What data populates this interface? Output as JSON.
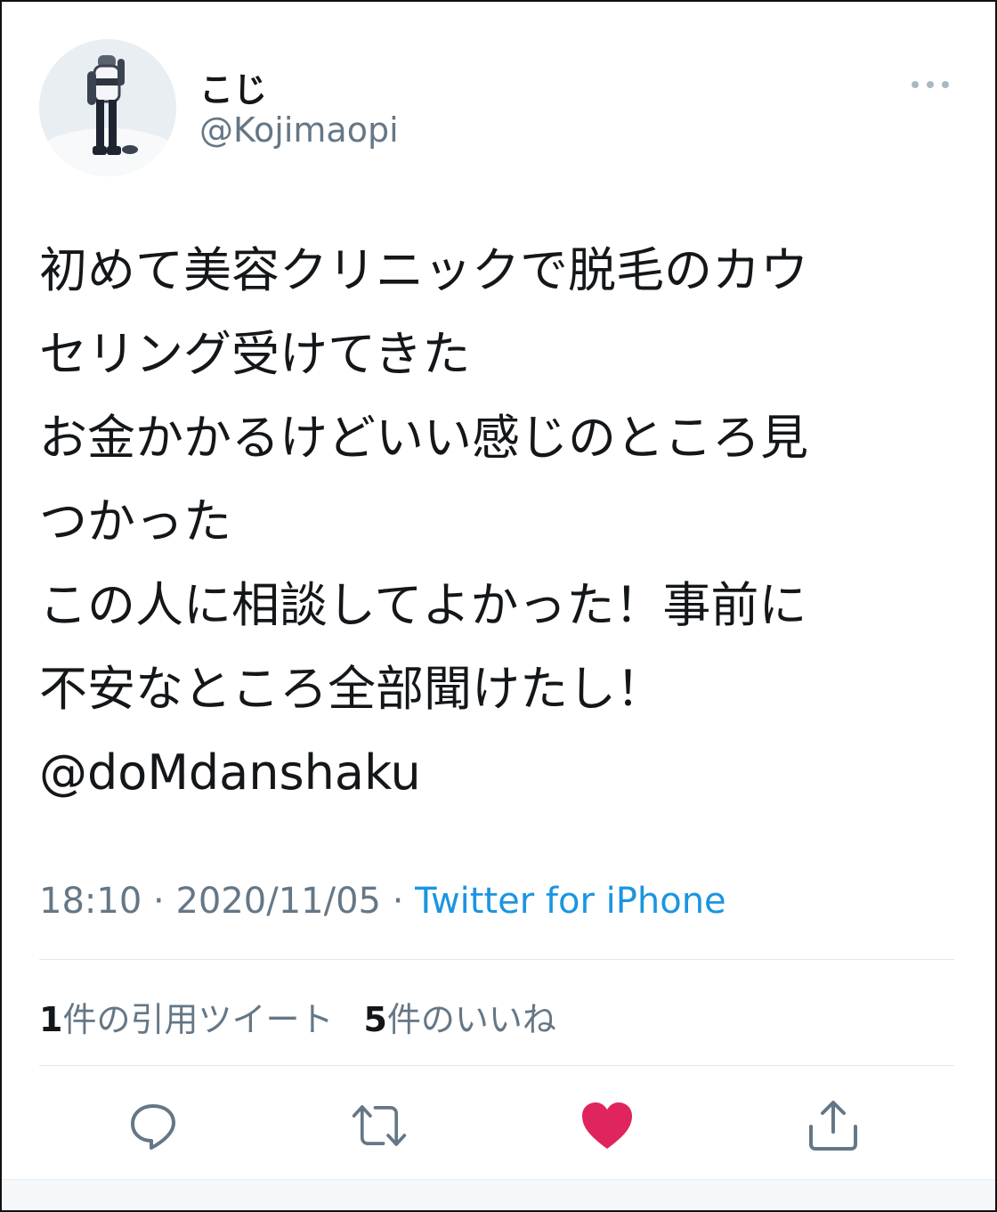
{
  "user": {
    "display_name": "こじ",
    "handle": "@Kojimaopi"
  },
  "tweet": {
    "text": "初めて美容クリニックで脱毛のカウ\nセリング受けてきた\nお金かかるけどいい感じのところ見\nつかった\nこの人に相談してよかった！事前に\n不安なところ全部聞けたし！\n@doMdanshaku",
    "time": "18:10",
    "separator": "·",
    "date": "2020/11/05",
    "source": "Twitter for iPhone"
  },
  "stats": {
    "quote_count": "1",
    "quote_label": "件の引用ツイート",
    "like_count": "5",
    "like_label": "件のいいね"
  },
  "icons": {
    "more": "more-horizontal-icon",
    "reply": "reply-icon",
    "retweet": "retweet-icon",
    "like": "heart-icon",
    "share": "share-icon"
  },
  "colors": {
    "link": "#1b95e0",
    "secondary_text": "#657786",
    "like_active": "#e0245e",
    "action_icon": "#657786"
  }
}
